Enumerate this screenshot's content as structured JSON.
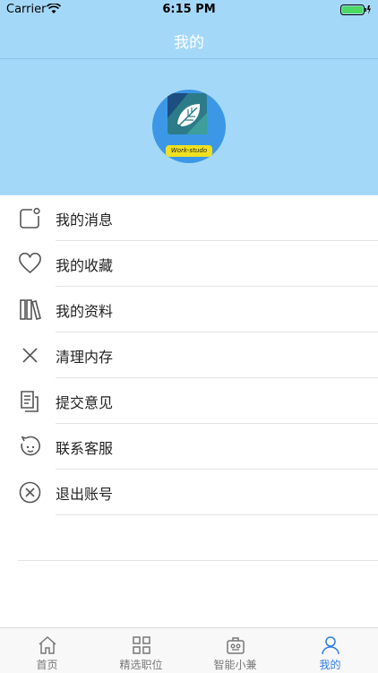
{
  "status_bar": {
    "carrier": "Carrier",
    "time": "6:15 PM"
  },
  "nav": {
    "title": "我的"
  },
  "profile": {
    "avatar_text": "Work-studo"
  },
  "menu": [
    {
      "label": "我的消息",
      "icon": "message-icon"
    },
    {
      "label": "我的收藏",
      "icon": "heart-icon"
    },
    {
      "label": "我的资料",
      "icon": "books-icon"
    },
    {
      "label": "清理内存",
      "icon": "close-icon"
    },
    {
      "label": "提交意见",
      "icon": "document-icon"
    },
    {
      "label": "联系客服",
      "icon": "service-icon"
    },
    {
      "label": "退出账号",
      "icon": "logout-icon"
    }
  ],
  "tabs": [
    {
      "label": "首页",
      "icon": "home-icon",
      "active": false
    },
    {
      "label": "精选职位",
      "icon": "grid-icon",
      "active": false
    },
    {
      "label": "智能小兼",
      "icon": "robot-icon",
      "active": false
    },
    {
      "label": "我的",
      "icon": "user-icon",
      "active": true
    }
  ],
  "colors": {
    "header_bg": "#a4d8f8",
    "accent": "#2f7ee8",
    "avatar_bg": "#3c98e6"
  }
}
